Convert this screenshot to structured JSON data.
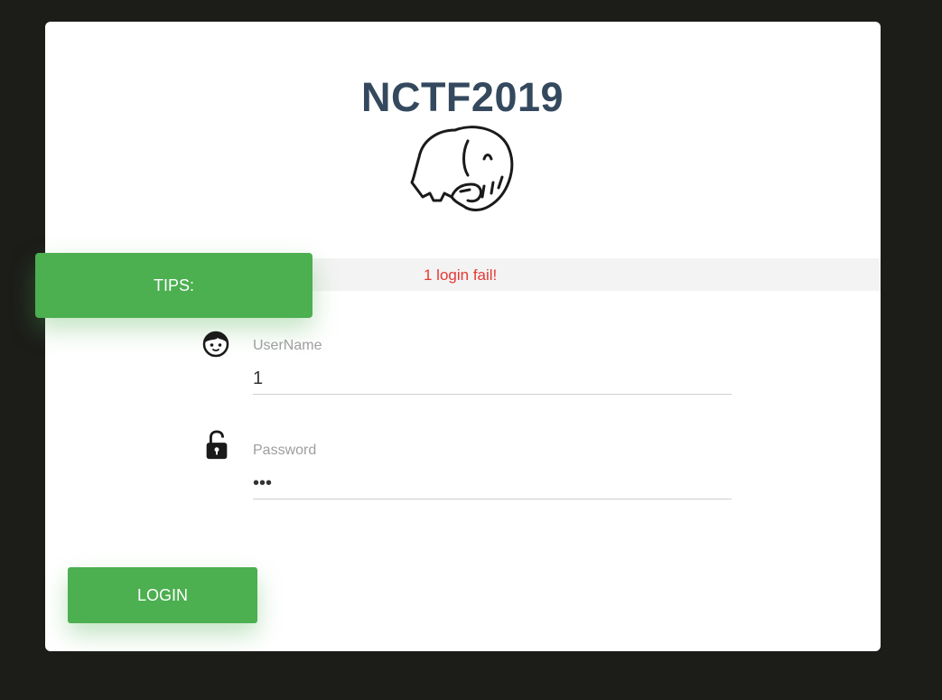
{
  "page": {
    "title": "NCTF2019"
  },
  "tips": {
    "label": "TIPS:",
    "message": "1 login fail!"
  },
  "form": {
    "username": {
      "label": "UserName",
      "value": "1",
      "icon": "user-face-icon"
    },
    "password": {
      "label": "Password",
      "value": "•••",
      "icon": "unlocked-padlock-icon"
    },
    "login_label": "LOGIN"
  },
  "colors": {
    "background": "#1c1c19",
    "accent": "#4caf50",
    "error": "#e53935",
    "title": "#34495e"
  },
  "logo": {
    "icon": "elephant-logo-icon"
  }
}
